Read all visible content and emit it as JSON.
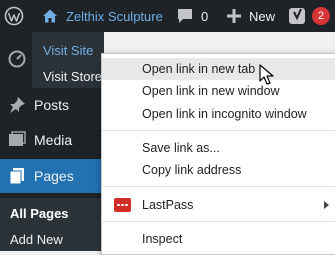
{
  "admin_bar": {
    "site_name": "Zelthix Sculpture",
    "comments_count": "0",
    "new_label": "New",
    "updates_count": "2"
  },
  "site_dropdown": {
    "items": [
      {
        "label": "Visit Site"
      },
      {
        "label": "Visit Store"
      }
    ]
  },
  "sidebar": {
    "items": [
      {
        "label": "Posts",
        "icon": "pin-icon"
      },
      {
        "label": "Media",
        "icon": "media-icon"
      },
      {
        "label": "Pages",
        "icon": "pages-icon"
      }
    ],
    "submenu": [
      {
        "label": "All Pages"
      },
      {
        "label": "Add New"
      }
    ]
  },
  "context_menu": {
    "items": [
      {
        "label": "Open link in new tab"
      },
      {
        "label": "Open link in new window"
      },
      {
        "label": "Open link in incognito window"
      },
      {
        "label": "Save link as..."
      },
      {
        "label": "Copy link address"
      },
      {
        "label": "LastPass"
      },
      {
        "label": "Inspect"
      }
    ]
  },
  "colors": {
    "admin_bar_bg": "#1d2327",
    "accent_blue": "#72aee6",
    "current_menu": "#2271b1",
    "badge_red": "#d63638",
    "lastpass_red": "#d32d27"
  }
}
